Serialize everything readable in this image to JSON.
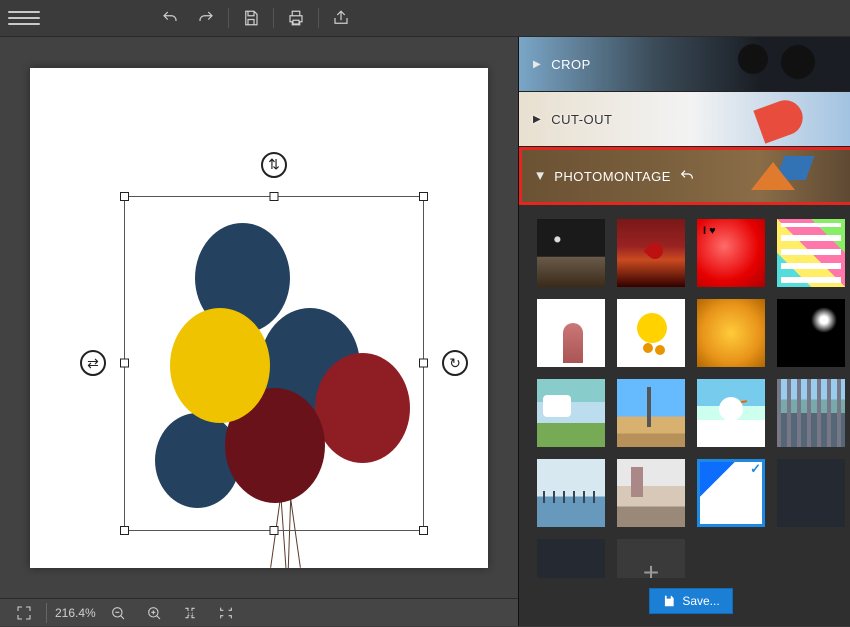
{
  "panels": {
    "crop": "CROP",
    "cutout": "CUT-OUT",
    "photomontage": "PHOTOMONTAGE"
  },
  "save_button": "Save...",
  "zoom_level": "216.4%",
  "templates": [
    {
      "name": "moon-landscape"
    },
    {
      "name": "heart-tree-sunset"
    },
    {
      "name": "red-i-love"
    },
    {
      "name": "comic-pop"
    },
    {
      "name": "white-puppy"
    },
    {
      "name": "yellow-monster"
    },
    {
      "name": "golden-bokeh"
    },
    {
      "name": "dark-sparkle"
    },
    {
      "name": "cow-field"
    },
    {
      "name": "eiffel-pier"
    },
    {
      "name": "snowman"
    },
    {
      "name": "city-skyline"
    },
    {
      "name": "venice-boats"
    },
    {
      "name": "winter-path"
    },
    {
      "name": "blank-corner",
      "selected": true
    },
    {
      "name": "dark-blank"
    }
  ]
}
